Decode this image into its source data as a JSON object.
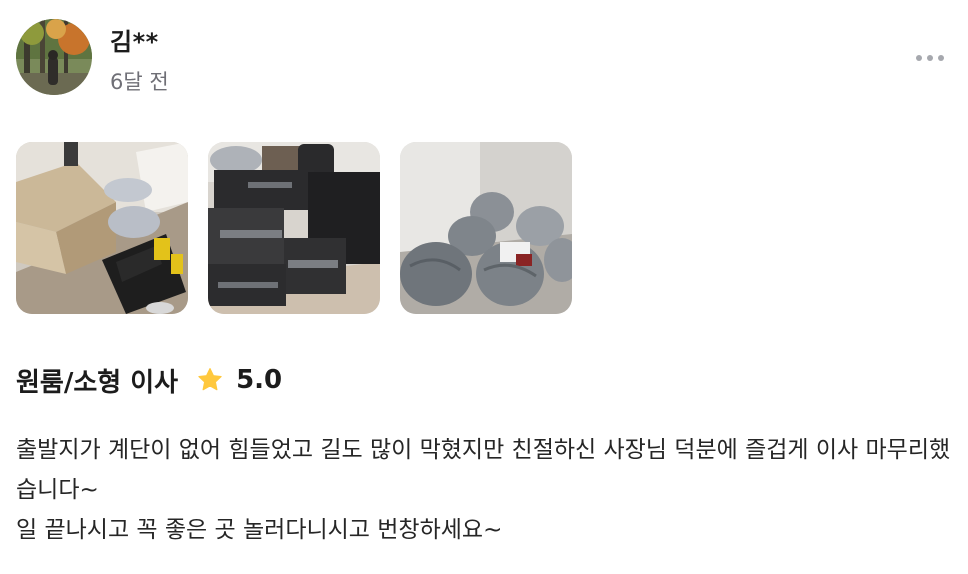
{
  "review": {
    "user_name": "김**",
    "time_ago": "6달 전",
    "service_title": "원룸/소형 이사",
    "rating": "5.0",
    "text_lines": [
      "출발지가 계단이 없어 힘들었고 길도 많이 막혔지만 친절하신 사장님 덕분에 즐겁게 이사 마무리했습니다~",
      "일 끝나시고 꼭 좋은 곳 놀러다니시고 번창하세요~"
    ]
  },
  "icons": {
    "more": "more-horizontal-icon",
    "star": "star-icon"
  },
  "colors": {
    "star": "#FFC83D",
    "muted": "#6F6F76",
    "text": "#1C1C1C"
  }
}
